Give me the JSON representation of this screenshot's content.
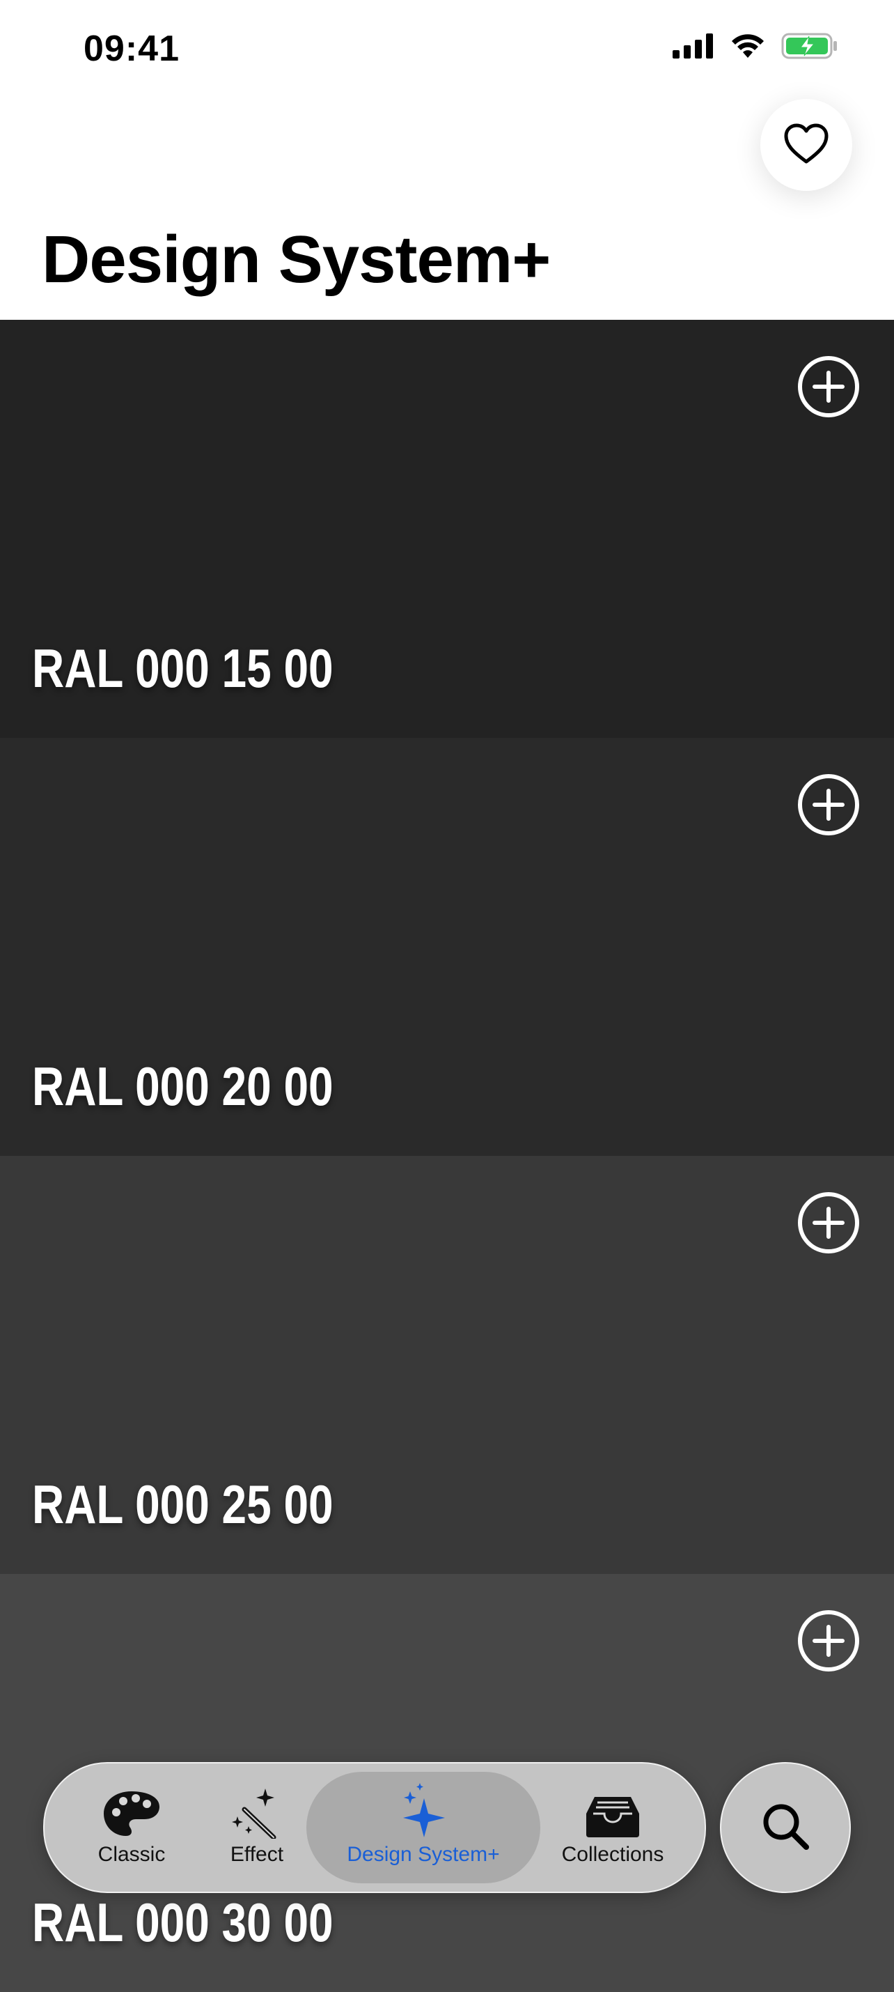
{
  "status_bar": {
    "time": "09:41",
    "icons": [
      "signal-icon",
      "wifi-icon",
      "battery-charging-icon"
    ],
    "battery_color": "#34c759"
  },
  "header": {
    "title": "Design System+",
    "favorite_icon": "heart-icon"
  },
  "swatches": [
    {
      "name": "RAL 000 15 00",
      "color": "#232323"
    },
    {
      "name": "RAL 000 20 00",
      "color": "#2a2a2a"
    },
    {
      "name": "RAL 000 25 00",
      "color": "#393939"
    },
    {
      "name": "RAL 000 30 00",
      "color": "#474747"
    }
  ],
  "swatch_action_icon": "plus-circle-icon",
  "tab_bar": {
    "tabs": [
      {
        "label": "Classic",
        "icon": "palette-icon",
        "selected": false
      },
      {
        "label": "Effect",
        "icon": "magic-wand-icon",
        "selected": false
      },
      {
        "label": "Design System+",
        "icon": "sparkles-icon",
        "selected": true
      },
      {
        "label": "Collections",
        "icon": "tray-icon",
        "selected": false
      }
    ],
    "selected_color": "#1a5fd6"
  },
  "search": {
    "icon": "magnifying-glass-icon"
  }
}
